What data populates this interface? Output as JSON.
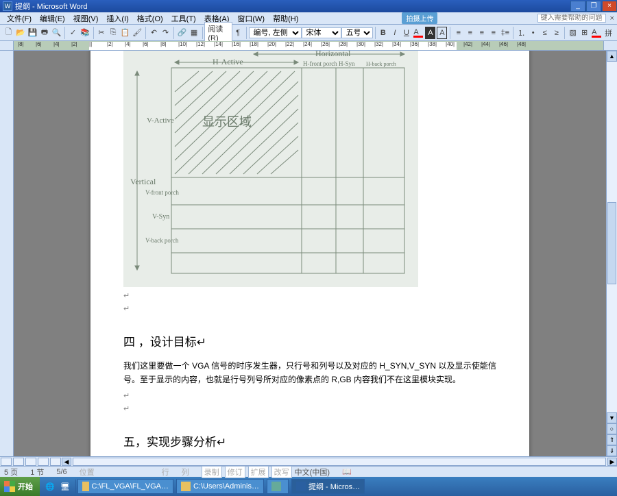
{
  "title": "提纲 - Microsoft Word",
  "menu": {
    "file": "文件(F)",
    "edit": "编辑(E)",
    "view": "视图(V)",
    "insert": "插入(I)",
    "format": "格式(O)",
    "tools": "工具(T)",
    "table": "表格(A)",
    "window": "窗口(W)",
    "help": "帮助(H)",
    "helpbox": "键入需要帮助的问题"
  },
  "toolbar": {
    "reading": "阅读(R)",
    "numbering_left": "编号, 左侧",
    "font": "宋体",
    "size": "五号",
    "upload": "拍摄上传"
  },
  "ruler": {
    "ticks": [
      "8",
      "6",
      "4",
      "2",
      "",
      "2",
      "4",
      "6",
      "8",
      "10",
      "12",
      "14",
      "16",
      "18",
      "20",
      "22",
      "24",
      "26",
      "28",
      "30",
      "32",
      "34",
      "36",
      "38",
      "40",
      "42",
      "44",
      "46",
      "48"
    ]
  },
  "doc": {
    "sketch": {
      "horizontal": "Horizontal",
      "hactive": "H-Active",
      "hfront": "H-front porch",
      "hsync": "H-Syn",
      "hback": "H-back porch",
      "vertical": "Vertical",
      "vactive": "V-Active",
      "vfront": "V-front porch",
      "vsync": "V-Syn",
      "vback": "V-back porch",
      "display": "显示区域"
    },
    "h4_num": "四 ，",
    "h4_title": "设计目标",
    "body4": "我们这里要做一个 VGA 信号的时序发生器，只行号和列号以及对应的 H_SYN,V_SYN 以及显示使能信号。至于显示的内容，也就是行号列号所对应的像素点的 R,GB 内容我们不在这里模块实现。",
    "h5_num": "五，",
    "h5_title": "实现步骤分析"
  },
  "status": {
    "page": "5 页",
    "section": "1 节",
    "pages": "5/6",
    "position": "位置",
    "line": "行",
    "col": "列",
    "rec": "录制",
    "rev": "修订",
    "ext": "扩展",
    "ovr": "改写",
    "lang": "中文(中国)"
  },
  "taskbar": {
    "start": "开始",
    "tasks": [
      {
        "label": "C:\\FL_VGA\\FL_VGA…"
      },
      {
        "label": "C:\\Users\\Adminis…"
      },
      {
        "label": "提纲 - Micros…"
      }
    ]
  }
}
